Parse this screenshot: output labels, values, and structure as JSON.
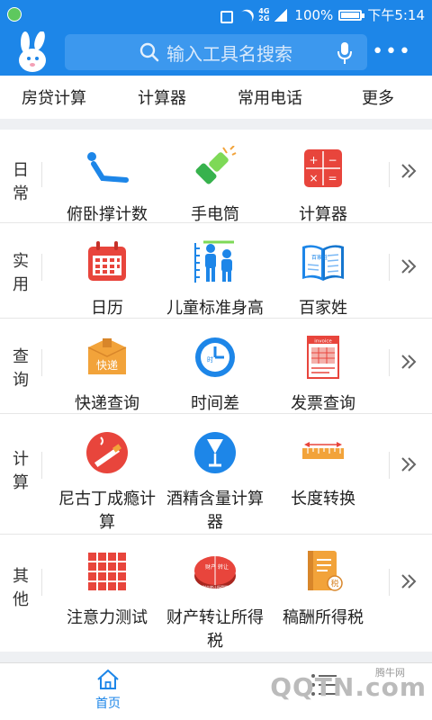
{
  "status_bar": {
    "net_top": "4G",
    "net_bottom": "2G",
    "battery": "100%",
    "time": "下午5:14"
  },
  "header": {
    "search_placeholder": "输入工具名搜索",
    "icons": [
      "rabbit-logo-icon",
      "search-icon",
      "microphone-icon",
      "more-icon"
    ]
  },
  "quicklinks": [
    "房贷计算",
    "计算器",
    "常用电话",
    "更多"
  ],
  "sections": [
    {
      "label": "日常",
      "tools": [
        "俯卧撑计数",
        "手电筒",
        "计算器"
      ]
    },
    {
      "label": "实用",
      "tools": [
        "日历",
        "儿童标准身高",
        "百家姓"
      ]
    },
    {
      "label": "查询",
      "tools": [
        "快递查询",
        "时间差",
        "发票查询"
      ]
    },
    {
      "label": "计算",
      "tools": [
        "尼古丁成瘾计算",
        "酒精含量计算器",
        "长度转换"
      ]
    },
    {
      "label": "其他",
      "tools": [
        "注意力测试",
        "财产转让所得税",
        "稿酬所得税"
      ]
    }
  ],
  "icon_text": {
    "express": "快递",
    "invoice": "invoice",
    "property_a": "财产",
    "property_b": "转让",
    "property_c": "财产转让所得税",
    "clock": "时",
    "tax": "税",
    "book": "百家姓"
  },
  "bottom_nav": {
    "home_label": "首页"
  },
  "watermark": {
    "text": "QQTN.com",
    "small": "腾牛网"
  },
  "colors": {
    "primary": "#1d86e8",
    "icon_red": "#e8453c",
    "icon_orange": "#f2a33a"
  }
}
